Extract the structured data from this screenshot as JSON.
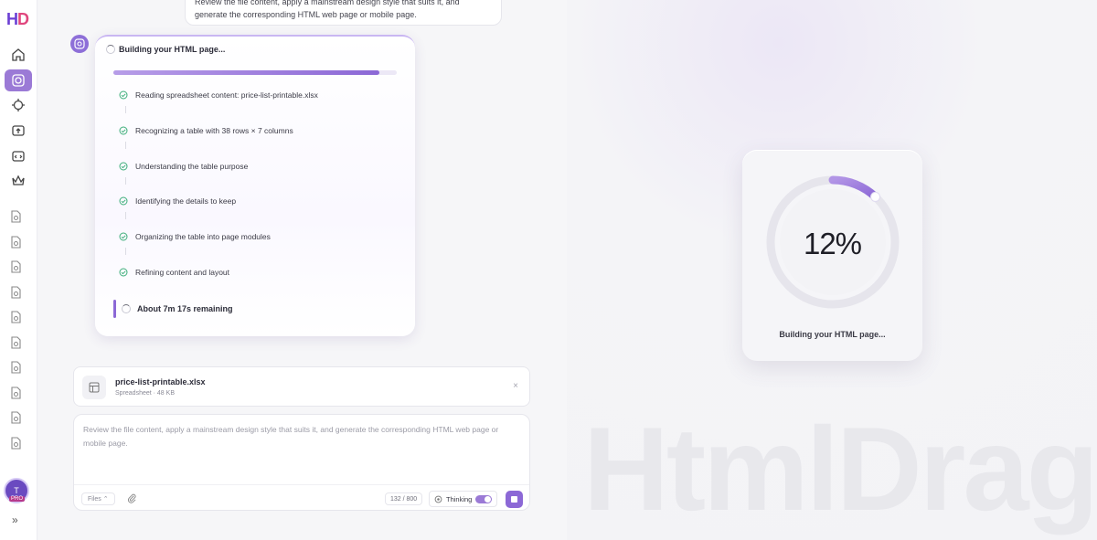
{
  "sidebar": {
    "logo": "HD",
    "nav": [
      {
        "name": "home-icon"
      },
      {
        "name": "generate-icon",
        "active": true
      },
      {
        "name": "target-icon"
      },
      {
        "name": "upload-icon"
      },
      {
        "name": "code-icon"
      },
      {
        "name": "crown-icon"
      }
    ],
    "history_count": 10,
    "avatar_initial": "T",
    "avatar_badge": "PRO",
    "expand_icon": "»"
  },
  "chat": {
    "prev_message": "Review the file content, apply a mainstream design style that suits it, and generate the corresponding HTML web page or mobile page.",
    "build": {
      "title": "Building your HTML page...",
      "progress": 0.94,
      "steps": [
        "Reading spreadsheet content: price-list-printable.xlsx",
        "Recognizing a table with 38 rows × 7 columns",
        "Understanding the table purpose",
        "Identifying the details to keep",
        "Organizing the table into page modules",
        "Refining content and layout"
      ],
      "remaining": "About 7m 17s remaining"
    },
    "attachment": {
      "name": "price-list-printable.xlsx",
      "meta": "Spreadsheet · 48 KB",
      "close": "×"
    },
    "composer": {
      "text": "Review the file content, apply a mainstream design style that suits it, and generate the corresponding HTML web page or mobile page.",
      "files_label": "Files ⌃",
      "counter": "132 / 800",
      "thinking_label": "Thinking",
      "thinking_on": true
    }
  },
  "preview": {
    "percent": "12%",
    "progress_value": 0.12,
    "label": "Building your HTML page...",
    "watermark": "HtmlDrag",
    "colors": {
      "accent": "#8c68d6",
      "track": "#ecebf1"
    }
  }
}
